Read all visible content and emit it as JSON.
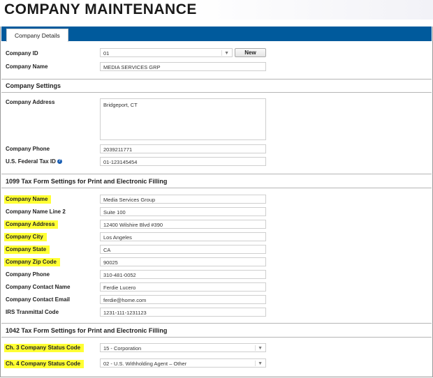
{
  "page": {
    "title": "COMPANY MAINTENANCE"
  },
  "tabs": [
    {
      "label": "Company Details"
    }
  ],
  "company": {
    "id_label": "Company ID",
    "id_value": "01",
    "new_button": "New",
    "name_label": "Company Name",
    "name_value": "MEDIA SERVICES GRP"
  },
  "settings": {
    "heading": "Company Settings",
    "address_label": "Company Address",
    "address_value": "Bridgeport, CT",
    "phone_label": "Company Phone",
    "phone_value": "2039211771",
    "taxid_label": "U.S. Federal Tax ID",
    "taxid_value": "01-123145454"
  },
  "form1099": {
    "heading": "1099 Tax Form Settings for Print and Electronic Filling",
    "fields": [
      {
        "label": "Company Name",
        "value": "Media Services Group",
        "highlighted": true
      },
      {
        "label": "Company Name Line 2",
        "value": "Suite 100",
        "highlighted": false
      },
      {
        "label": "Company Address",
        "value": "12400 Wilshire Blvd #390",
        "highlighted": true
      },
      {
        "label": "Company City",
        "value": "Los Angeles",
        "highlighted": true
      },
      {
        "label": "Company State",
        "value": "CA",
        "highlighted": true
      },
      {
        "label": "Company Zip Code",
        "value": "90025",
        "highlighted": true
      },
      {
        "label": "Company Phone",
        "value": "310-481-0052",
        "highlighted": false
      },
      {
        "label": "Company Contact Name",
        "value": "Ferdie Lucero",
        "highlighted": false
      },
      {
        "label": "Company Contact Email",
        "value": "ferdie@home.com",
        "highlighted": false
      },
      {
        "label": "IRS Tranmittal Code",
        "value": "1231-111-1231123",
        "highlighted": false
      }
    ]
  },
  "form1042": {
    "heading": "1042 Tax Form Settings for Print and Electronic Filling",
    "fields": [
      {
        "label": "Ch. 3 Company Status Code",
        "value": "15 - Corporation",
        "highlighted": true
      },
      {
        "label": "Ch. 4 Company Status Code",
        "value": "02 - U.S. Withholding Agent – Other",
        "highlighted": true
      }
    ]
  },
  "colors": {
    "tabbar": "#005a9c",
    "highlight": "#ffff33"
  }
}
